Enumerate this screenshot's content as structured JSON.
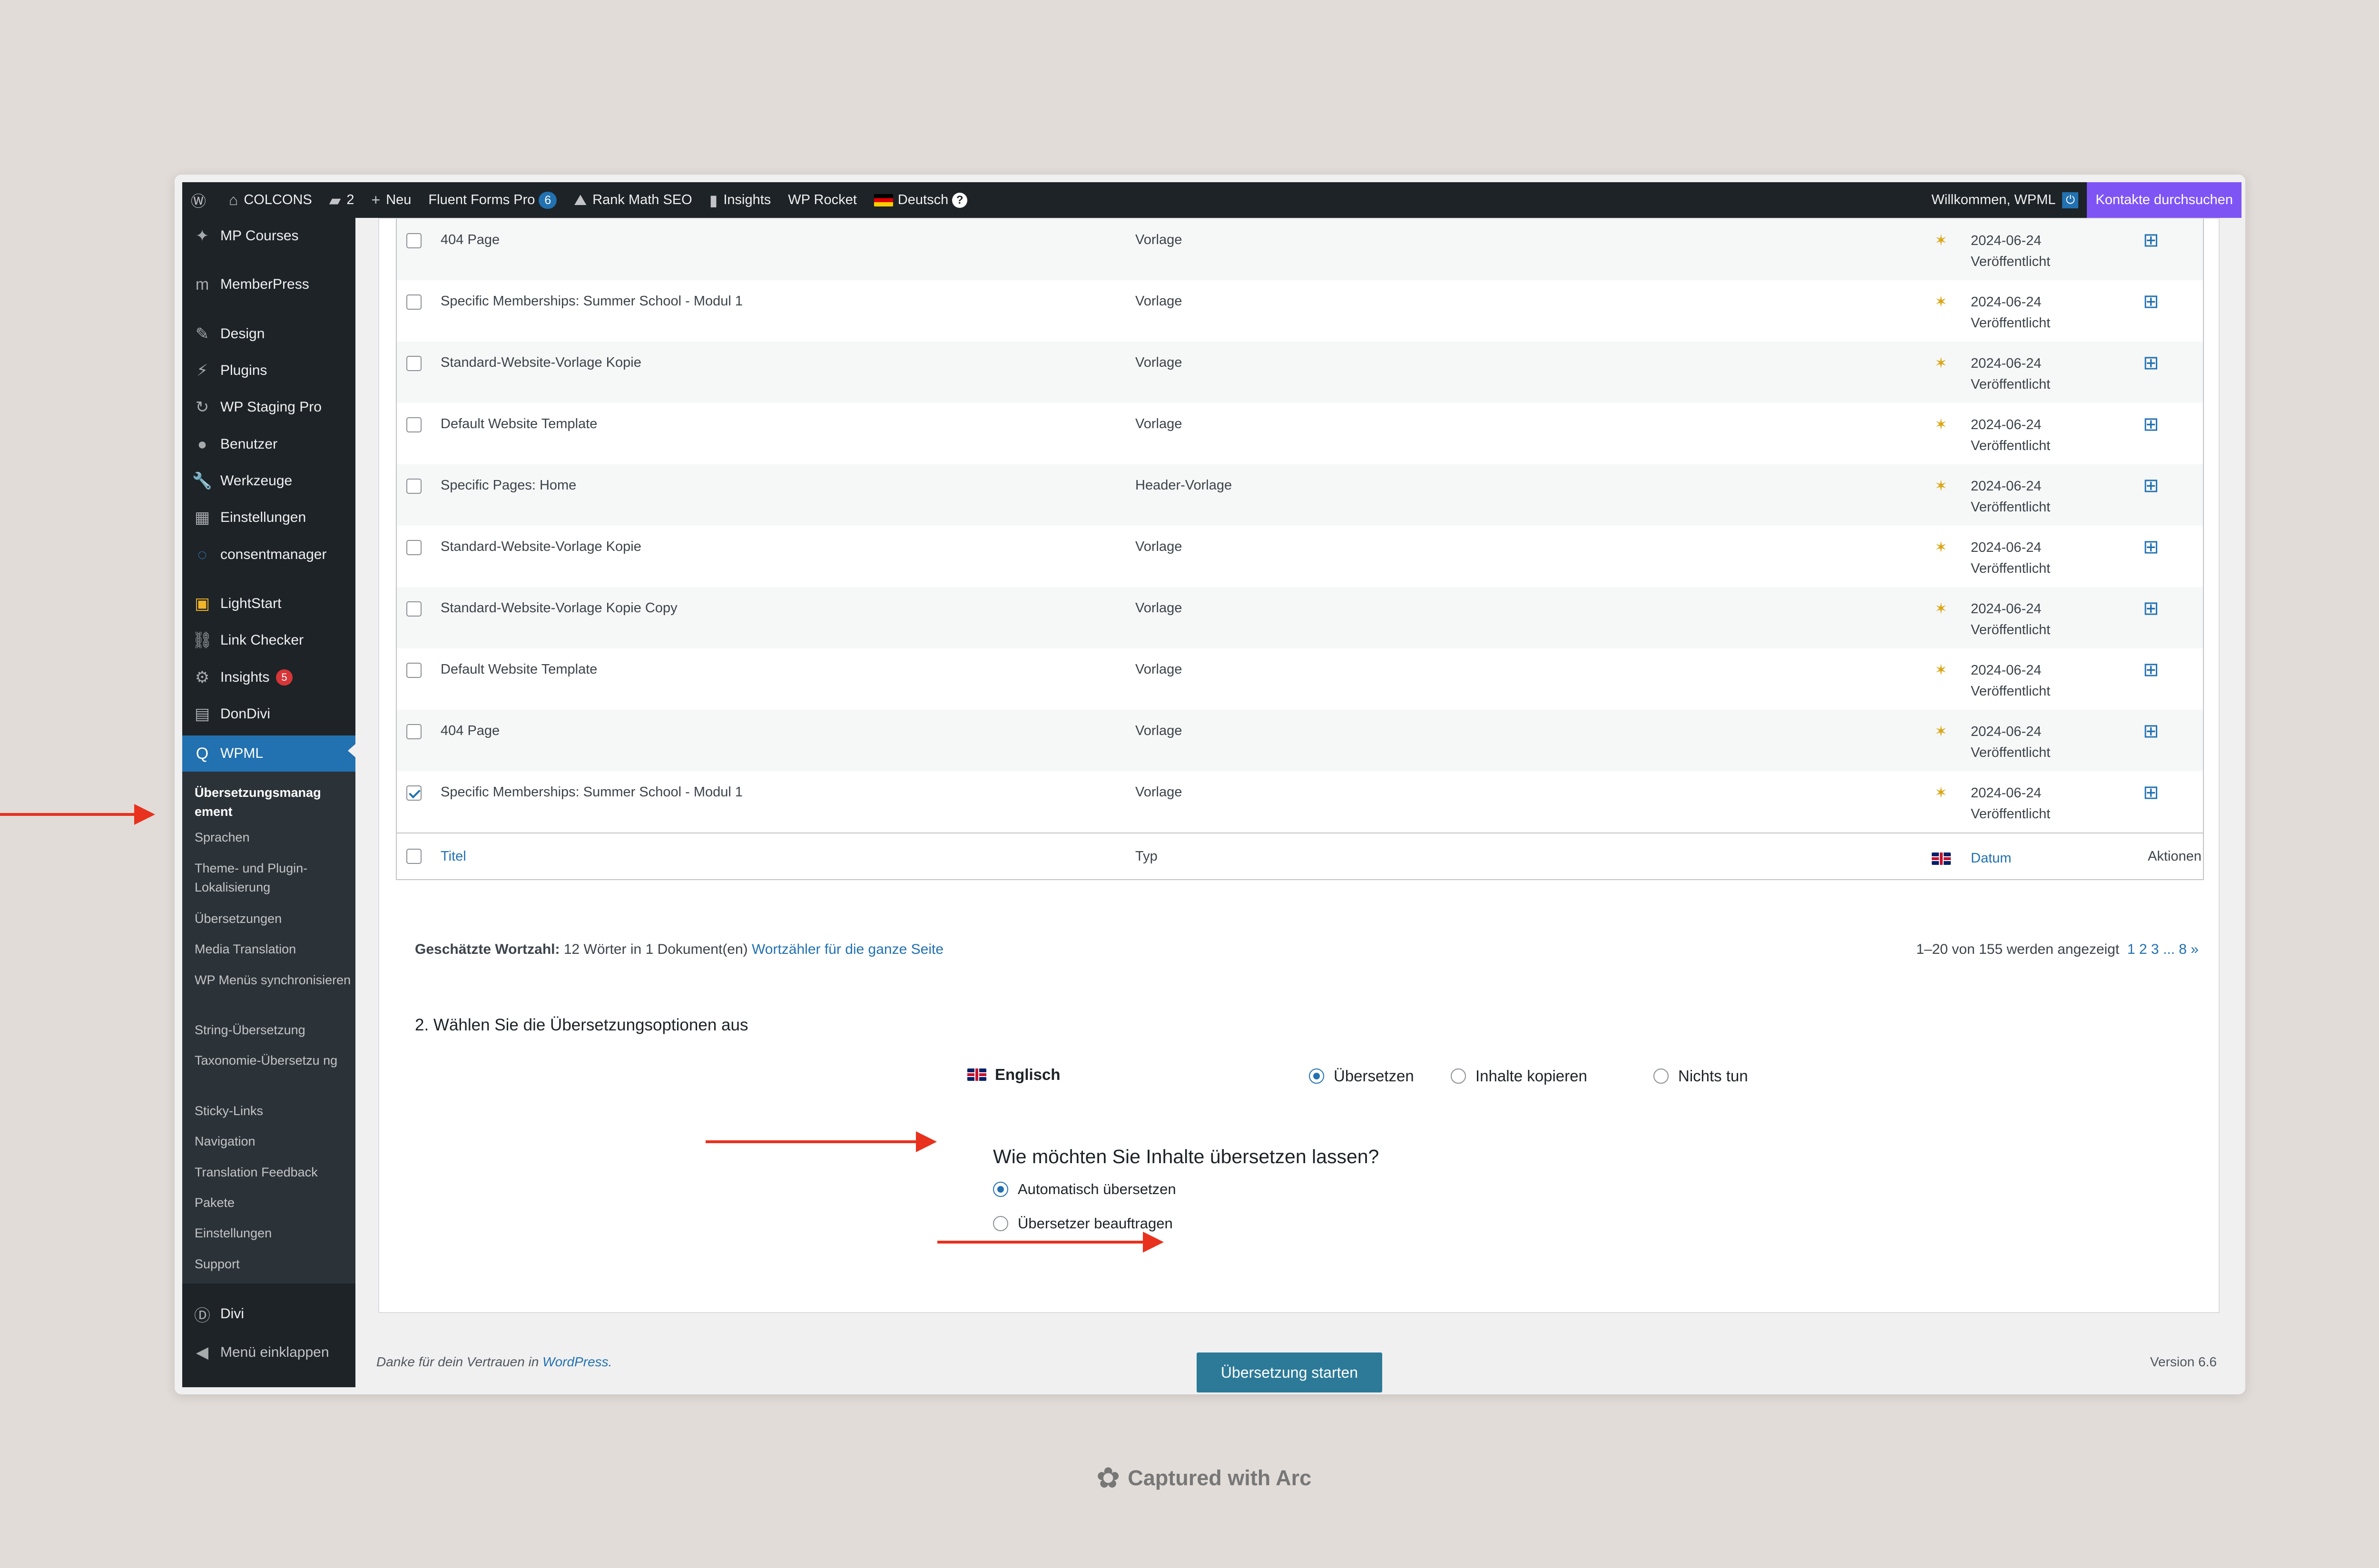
{
  "adminbar": {
    "site": "COLCONS",
    "comments": "2",
    "new": "Neu",
    "fluent": "Fluent Forms Pro",
    "fluent_count": "6",
    "rankmath": "Rank Math SEO",
    "insights": "Insights",
    "rocket": "WP Rocket",
    "language": "Deutsch",
    "welcome": "Willkommen, WPML",
    "contacts": "Kontakte durchsuchen"
  },
  "sidebar": {
    "items": [
      {
        "label": "MP Courses",
        "icon": "courses-icon"
      },
      {
        "label": "MemberPress",
        "icon": "memberpress-icon"
      },
      {
        "label": "Design",
        "icon": "brush-icon"
      },
      {
        "label": "Plugins",
        "icon": "plugin-icon"
      },
      {
        "label": "WP Staging Pro",
        "icon": "refresh-icon"
      },
      {
        "label": "Benutzer",
        "icon": "user-icon"
      },
      {
        "label": "Werkzeuge",
        "icon": "wrench-icon"
      },
      {
        "label": "Einstellungen",
        "icon": "settings-icon"
      },
      {
        "label": "consentmanager",
        "icon": "consent-icon"
      },
      {
        "label": "LightStart",
        "icon": "lightstart-icon"
      },
      {
        "label": "Link Checker",
        "icon": "link-icon"
      },
      {
        "label": "Insights",
        "icon": "insights-icon",
        "badge": "5"
      },
      {
        "label": "DonDivi",
        "icon": "dondivi-icon"
      },
      {
        "label": "WPML",
        "icon": "wpml-icon"
      }
    ],
    "submenu": [
      "Übersetzungsmanag ement",
      "Sprachen",
      "Theme- und Plugin-Lokalisierung",
      "Übersetzungen",
      "Media Translation",
      "WP Menüs synchronisieren",
      "String-Übersetzung",
      "Taxonomie-Übersetzu ng",
      "Sticky-Links",
      "Navigation",
      "Translation Feedback",
      "Pakete",
      "Einstellungen",
      "Support"
    ],
    "divi": "Divi",
    "collapse": "Menü einklappen"
  },
  "table": {
    "rows": [
      {
        "title": "404 Page",
        "type": "Vorlage",
        "date": "2024-06-24",
        "status": "Veröffentlicht",
        "checked": false
      },
      {
        "title": "Specific Memberships: Summer School - Modul 1",
        "type": "Vorlage",
        "date": "2024-06-24",
        "status": "Veröffentlicht",
        "checked": false
      },
      {
        "title": "Standard-Website-Vorlage Kopie",
        "type": "Vorlage",
        "date": "2024-06-24",
        "status": "Veröffentlicht",
        "checked": false
      },
      {
        "title": "Default Website Template",
        "type": "Vorlage",
        "date": "2024-06-24",
        "status": "Veröffentlicht",
        "checked": false
      },
      {
        "title": "Specific Pages: Home",
        "type": "Header-Vorlage",
        "date": "2024-06-24",
        "status": "Veröffentlicht",
        "checked": false
      },
      {
        "title": "Standard-Website-Vorlage Kopie",
        "type": "Vorlage",
        "date": "2024-06-24",
        "status": "Veröffentlicht",
        "checked": false
      },
      {
        "title": "Standard-Website-Vorlage Kopie Copy",
        "type": "Vorlage",
        "date": "2024-06-24",
        "status": "Veröffentlicht",
        "checked": false
      },
      {
        "title": "Default Website Template",
        "type": "Vorlage",
        "date": "2024-06-24",
        "status": "Veröffentlicht",
        "checked": false
      },
      {
        "title": "404 Page",
        "type": "Vorlage",
        "date": "2024-06-24",
        "status": "Veröffentlicht",
        "checked": false
      },
      {
        "title": "Specific Memberships: Summer School - Modul 1",
        "type": "Vorlage",
        "date": "2024-06-24",
        "status": "Veröffentlicht",
        "checked": true
      }
    ],
    "footer": {
      "title": "Titel",
      "type": "Typ",
      "date": "Datum",
      "actions": "Aktionen"
    }
  },
  "wordcount": {
    "label": "Geschätzte Wortzahl:",
    "value": "12 Wörter in 1 Dokument(en)",
    "link": "Wortzähler für die ganze Seite"
  },
  "pagination": {
    "info": "1–20 von 155 werden angezeigt",
    "pages": "1 2 3 ... 8 »"
  },
  "options": {
    "heading": "2. Wählen Sie die Übersetzungsoptionen aus",
    "language": "Englisch",
    "choices": [
      "Übersetzen",
      "Inhalte kopieren",
      "Nichts tun"
    ],
    "question": "Wie möchten Sie Inhalte übersetzen lassen?",
    "methods": [
      "Automatisch übersetzen",
      "Übersetzer beauftragen"
    ],
    "start_button": "Übersetzung starten"
  },
  "footer": {
    "thanks": "Danke für dein Vertrauen in",
    "wordpress": "WordPress.",
    "version": "Version 6.6"
  },
  "capture": "Captured with Arc",
  "colors": {
    "accent": "#2271b1",
    "arrow": "#e8321e",
    "purple": "#7f54f5"
  }
}
